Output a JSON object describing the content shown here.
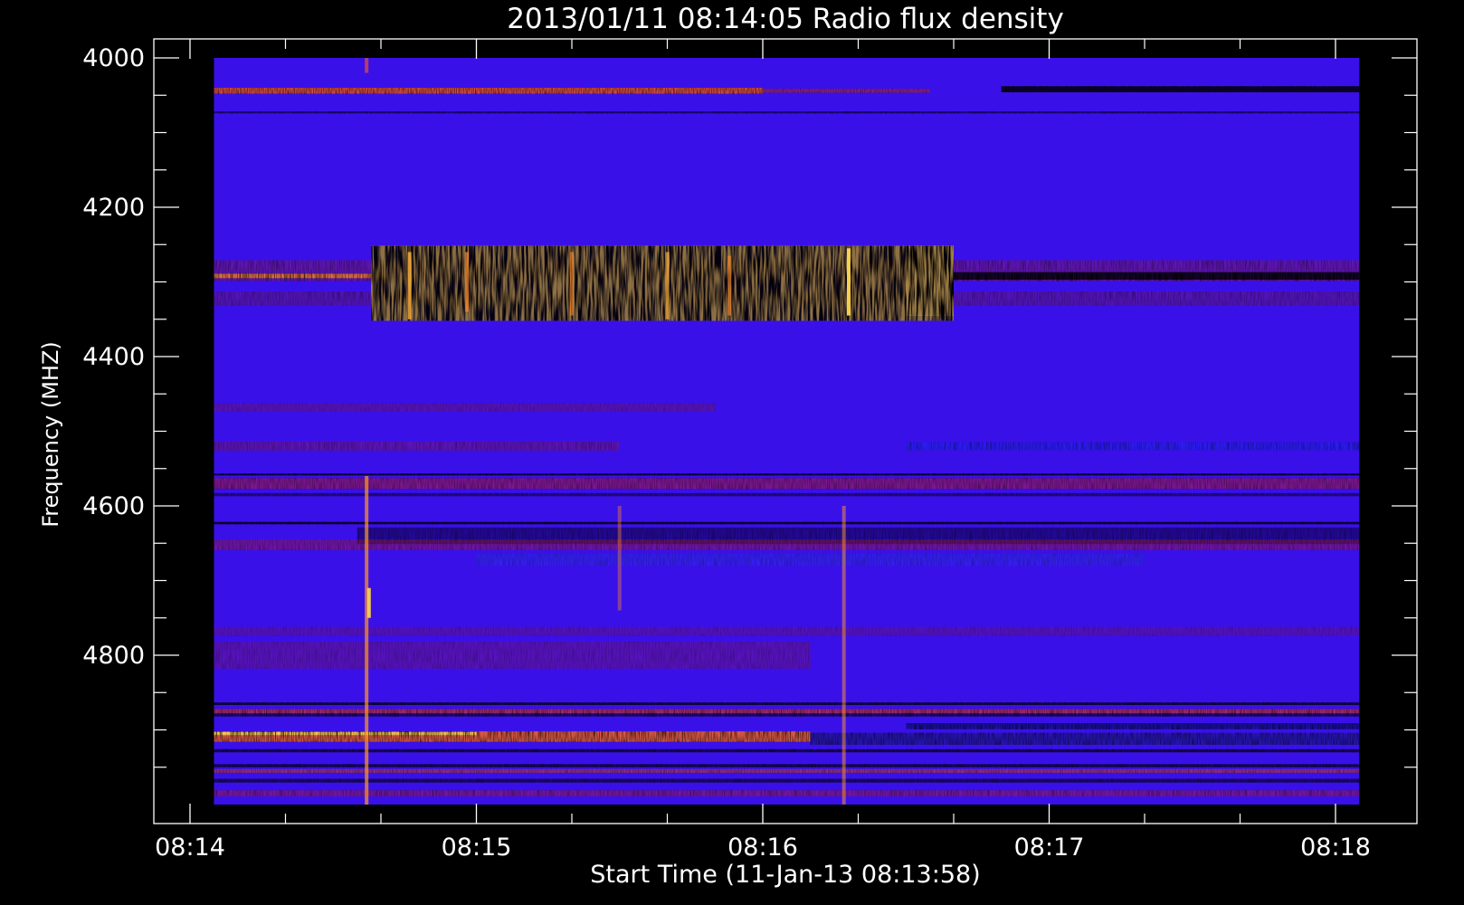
{
  "chart_data": {
    "type": "heatmap",
    "title": "2013/01/11 08:14:05 Radio flux density",
    "xlabel": "Start Time (11-Jan-13 08:13:58)",
    "ylabel": "Frequency (MHZ)",
    "x_ticks": [
      "08:14",
      "08:15",
      "08:16",
      "08:17",
      "08:18"
    ],
    "y_ticks": [
      "4000",
      "4200",
      "4400",
      "4600",
      "4800"
    ],
    "xlim_seconds_after_0814": [
      -7,
      258
    ],
    "data_x_range_seconds_after_0814": [
      5,
      245
    ],
    "ylim_mhz": [
      4000,
      5025
    ],
    "data_y_range_mhz": [
      4000,
      5000
    ],
    "colors": {
      "background_flux": "#3a10e8",
      "low_flux": "#000000",
      "medium_flux": "#c81e3c",
      "high_flux": "#ffd850",
      "axes": "#ffffff"
    },
    "features": {
      "horizontal_bands": [
        {
          "freq_mhz": 4044,
          "width_mhz": 8,
          "color": "#ff5a1e",
          "t_start": 5,
          "t_end": 120,
          "intensity": 0.95
        },
        {
          "freq_mhz": 4044,
          "width_mhz": 5,
          "color": "#d02a3c",
          "t_start": 120,
          "t_end": 155,
          "intensity": 0.7
        },
        {
          "freq_mhz": 4042,
          "width_mhz": 8,
          "color": "#000000",
          "t_start": 170,
          "t_end": 245,
          "intensity": 0.95
        },
        {
          "freq_mhz": 4073,
          "width_mhz": 2,
          "color": "#000018",
          "t_start": 5,
          "t_end": 245,
          "intensity": 0.6
        },
        {
          "freq_mhz": 4285,
          "width_mhz": 28,
          "color": "#8a1c78",
          "t_start": 5,
          "t_end": 245,
          "intensity": 0.55
        },
        {
          "freq_mhz": 4292,
          "width_mhz": 6,
          "color": "#ff8a28",
          "t_start": 5,
          "t_end": 42,
          "intensity": 0.95
        },
        {
          "freq_mhz": 4292,
          "width_mhz": 10,
          "color": "#000000",
          "t_start": 157,
          "t_end": 245,
          "intensity": 0.9
        },
        {
          "freq_mhz": 4322,
          "width_mhz": 18,
          "color": "#7a1c6e",
          "t_start": 5,
          "t_end": 245,
          "intensity": 0.45
        },
        {
          "freq_mhz": 4468,
          "width_mhz": 10,
          "color": "#9a1c54",
          "t_start": 5,
          "t_end": 110,
          "intensity": 0.35
        },
        {
          "freq_mhz": 4520,
          "width_mhz": 12,
          "color": "#9a1c54",
          "t_start": 5,
          "t_end": 90,
          "intensity": 0.4
        },
        {
          "freq_mhz": 4520,
          "width_mhz": 10,
          "color": "#1a2aff",
          "t_start": 150,
          "t_end": 245,
          "intensity": 0.5
        },
        {
          "freq_mhz": 4558,
          "width_mhz": 2,
          "color": "#000000",
          "t_start": 5,
          "t_end": 245,
          "intensity": 0.8
        },
        {
          "freq_mhz": 4570,
          "width_mhz": 14,
          "color": "#c0203c",
          "t_start": 5,
          "t_end": 245,
          "intensity": 0.6
        },
        {
          "freq_mhz": 4585,
          "width_mhz": 4,
          "color": "#000000",
          "t_start": 5,
          "t_end": 245,
          "intensity": 0.45
        },
        {
          "freq_mhz": 4623,
          "width_mhz": 3,
          "color": "#000000",
          "t_start": 5,
          "t_end": 245,
          "intensity": 0.9
        },
        {
          "freq_mhz": 4640,
          "width_mhz": 22,
          "color": "#000010",
          "t_start": 35,
          "t_end": 245,
          "intensity": 0.45
        },
        {
          "freq_mhz": 4652,
          "width_mhz": 14,
          "color": "#c0203c",
          "t_start": 5,
          "t_end": 245,
          "intensity": 0.45
        },
        {
          "freq_mhz": 4672,
          "width_mhz": 16,
          "color": "#2a40ff",
          "t_start": 60,
          "t_end": 200,
          "intensity": 0.35
        },
        {
          "freq_mhz": 4768,
          "width_mhz": 12,
          "color": "#9a1c54",
          "t_start": 5,
          "t_end": 245,
          "intensity": 0.3
        },
        {
          "freq_mhz": 4800,
          "width_mhz": 36,
          "color": "#9a1c54",
          "t_start": 5,
          "t_end": 130,
          "intensity": 0.35
        },
        {
          "freq_mhz": 4865,
          "width_mhz": 3,
          "color": "#000000",
          "t_start": 5,
          "t_end": 245,
          "intensity": 0.9
        },
        {
          "freq_mhz": 4875,
          "width_mhz": 6,
          "color": "#e03830",
          "t_start": 5,
          "t_end": 245,
          "intensity": 0.75
        },
        {
          "freq_mhz": 4880,
          "width_mhz": 4,
          "color": "#000000",
          "t_start": 5,
          "t_end": 245,
          "intensity": 0.6
        },
        {
          "freq_mhz": 4895,
          "width_mhz": 8,
          "color": "#0b1080",
          "t_start": 150,
          "t_end": 245,
          "intensity": 0.8
        },
        {
          "freq_mhz": 4909,
          "width_mhz": 14,
          "color": "#ff6a1e",
          "t_start": 5,
          "t_end": 130,
          "intensity": 0.95
        },
        {
          "freq_mhz": 4905,
          "width_mhz": 4,
          "color": "#ffdc5a",
          "t_start": 5,
          "t_end": 60,
          "intensity": 0.95
        },
        {
          "freq_mhz": 4912,
          "width_mhz": 16,
          "color": "#1a1a8a",
          "t_start": 130,
          "t_end": 245,
          "intensity": 0.7
        },
        {
          "freq_mhz": 4928,
          "width_mhz": 4,
          "color": "#000000",
          "t_start": 5,
          "t_end": 245,
          "intensity": 0.7
        },
        {
          "freq_mhz": 4948,
          "width_mhz": 4,
          "color": "#000000",
          "t_start": 5,
          "t_end": 245,
          "intensity": 0.7
        },
        {
          "freq_mhz": 4955,
          "width_mhz": 5,
          "color": "#e04a30",
          "t_start": 5,
          "t_end": 245,
          "intensity": 0.6
        },
        {
          "freq_mhz": 4968,
          "width_mhz": 5,
          "color": "#000000",
          "t_start": 5,
          "t_end": 245,
          "intensity": 0.6
        },
        {
          "freq_mhz": 4985,
          "width_mhz": 8,
          "color": "#c0203c",
          "t_start": 5,
          "t_end": 245,
          "intensity": 0.5
        }
      ],
      "dark_blocks": [
        {
          "t_start": 38,
          "t_end": 160,
          "f_start": 4252,
          "f_end": 4352,
          "color": "#000000",
          "intensity": 0.92
        },
        {
          "t_start": 150,
          "t_end": 160,
          "f_start": 4252,
          "f_end": 4345,
          "color": "#000000",
          "intensity": 0.6
        }
      ],
      "vertical_streaks": [
        {
          "t": 37,
          "f_start": 4560,
          "f_end": 5000,
          "color": "#ff9a28",
          "intensity": 0.7
        },
        {
          "t": 37.5,
          "f_start": 4710,
          "f_end": 4750,
          "color": "#ffd850",
          "intensity": 0.9
        },
        {
          "t": 37,
          "f_start": 4000,
          "f_end": 4020,
          "color": "#ff5a1e",
          "intensity": 0.6
        },
        {
          "t": 46,
          "f_start": 4260,
          "f_end": 4350,
          "color": "#ffb03a",
          "intensity": 0.8
        },
        {
          "t": 58,
          "f_start": 4260,
          "f_end": 4340,
          "color": "#ff8a28",
          "intensity": 0.7
        },
        {
          "t": 80,
          "f_start": 4260,
          "f_end": 4345,
          "color": "#ff8a28",
          "intensity": 0.6
        },
        {
          "t": 100,
          "f_start": 4260,
          "f_end": 4350,
          "color": "#ffb03a",
          "intensity": 0.7
        },
        {
          "t": 113,
          "f_start": 4265,
          "f_end": 4345,
          "color": "#ff8a28",
          "intensity": 0.6
        },
        {
          "t": 138,
          "f_start": 4255,
          "f_end": 4345,
          "color": "#ffd850",
          "intensity": 0.95
        },
        {
          "t": 137,
          "f_start": 4600,
          "f_end": 5000,
          "color": "#ff9a28",
          "intensity": 0.5
        },
        {
          "t": 90,
          "f_start": 4600,
          "f_end": 4740,
          "color": "#ff8a28",
          "intensity": 0.4
        }
      ]
    }
  }
}
